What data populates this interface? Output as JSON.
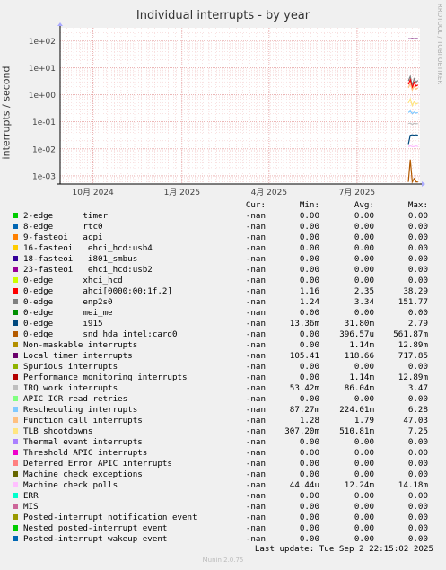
{
  "title": "Individual interrupts - by year",
  "side_text": "RRDTOOL / TOBI OETIKER",
  "ylabel": "interrupts / second",
  "header": {
    "cur": "Cur:",
    "min": "Min:",
    "avg": "Avg:",
    "max": "Max:"
  },
  "rows": [
    {
      "name": "2-edge      timer",
      "color": "#00cc00",
      "cur": "-nan",
      "min": "0.00",
      "avg": "0.00",
      "max": "0.00"
    },
    {
      "name": "8-edge      rtc0",
      "color": "#0066b3",
      "cur": "-nan",
      "min": "0.00",
      "avg": "0.00",
      "max": "0.00"
    },
    {
      "name": "9-fasteoi   acpi",
      "color": "#ff8000",
      "cur": "-nan",
      "min": "0.00",
      "avg": "0.00",
      "max": "0.00"
    },
    {
      "name": "16-fasteoi   ehci_hcd:usb4",
      "color": "#ffcc00",
      "cur": "-nan",
      "min": "0.00",
      "avg": "0.00",
      "max": "0.00"
    },
    {
      "name": "18-fasteoi   i801_smbus",
      "color": "#330099",
      "cur": "-nan",
      "min": "0.00",
      "avg": "0.00",
      "max": "0.00"
    },
    {
      "name": "23-fasteoi   ehci_hcd:usb2",
      "color": "#990099",
      "cur": "-nan",
      "min": "0.00",
      "avg": "0.00",
      "max": "0.00"
    },
    {
      "name": "0-edge      xhci_hcd",
      "color": "#ccff00",
      "cur": "-nan",
      "min": "0.00",
      "avg": "0.00",
      "max": "0.00"
    },
    {
      "name": "0-edge      ahci[0000:00:1f.2]",
      "color": "#ff0000",
      "cur": "-nan",
      "min": "1.16",
      "avg": "2.35",
      "max": "38.29"
    },
    {
      "name": "0-edge      enp2s0",
      "color": "#808080",
      "cur": "-nan",
      "min": "1.24",
      "avg": "3.34",
      "max": "151.77"
    },
    {
      "name": "0-edge      mei_me",
      "color": "#008f00",
      "cur": "-nan",
      "min": "0.00",
      "avg": "0.00",
      "max": "0.00"
    },
    {
      "name": "0-edge      i915",
      "color": "#00487d",
      "cur": "-nan",
      "min": "13.36m",
      "avg": "31.80m",
      "max": "2.79"
    },
    {
      "name": "0-edge      snd_hda_intel:card0",
      "color": "#b35a00",
      "cur": "-nan",
      "min": "0.00",
      "avg": "396.57u",
      "max": "561.87m"
    },
    {
      "name": "Non-maskable interrupts",
      "color": "#b38f00",
      "cur": "-nan",
      "min": "0.00",
      "avg": "1.14m",
      "max": "12.89m"
    },
    {
      "name": "Local timer interrupts",
      "color": "#6b006b",
      "cur": "-nan",
      "min": "105.41",
      "avg": "118.66",
      "max": "717.85"
    },
    {
      "name": "Spurious interrupts",
      "color": "#8fb300",
      "cur": "-nan",
      "min": "0.00",
      "avg": "0.00",
      "max": "0.00"
    },
    {
      "name": "Performance monitoring interrupts",
      "color": "#b30000",
      "cur": "-nan",
      "min": "0.00",
      "avg": "1.14m",
      "max": "12.89m"
    },
    {
      "name": "IRQ work interrupts",
      "color": "#bebebe",
      "cur": "-nan",
      "min": "53.42m",
      "avg": "86.04m",
      "max": "3.47"
    },
    {
      "name": "APIC ICR read retries",
      "color": "#80ff80",
      "cur": "-nan",
      "min": "0.00",
      "avg": "0.00",
      "max": "0.00"
    },
    {
      "name": "Rescheduling interrupts",
      "color": "#80c9ff",
      "cur": "-nan",
      "min": "87.27m",
      "avg": "224.01m",
      "max": "6.28"
    },
    {
      "name": "Function call interrupts",
      "color": "#ffc080",
      "cur": "-nan",
      "min": "1.28",
      "avg": "1.79",
      "max": "47.03"
    },
    {
      "name": "TLB shootdowns",
      "color": "#ffe680",
      "cur": "-nan",
      "min": "307.20m",
      "avg": "510.81m",
      "max": "7.25"
    },
    {
      "name": "Thermal event interrupts",
      "color": "#aa80ff",
      "cur": "-nan",
      "min": "0.00",
      "avg": "0.00",
      "max": "0.00"
    },
    {
      "name": "Threshold APIC interrupts",
      "color": "#ee00cc",
      "cur": "-nan",
      "min": "0.00",
      "avg": "0.00",
      "max": "0.00"
    },
    {
      "name": "Deferred Error APIC interrupts",
      "color": "#ff8080",
      "cur": "-nan",
      "min": "0.00",
      "avg": "0.00",
      "max": "0.00"
    },
    {
      "name": "Machine check exceptions",
      "color": "#666600",
      "cur": "-nan",
      "min": "0.00",
      "avg": "0.00",
      "max": "0.00"
    },
    {
      "name": "Machine check polls",
      "color": "#ffbfff",
      "cur": "-nan",
      "min": "44.44u",
      "avg": "12.24m",
      "max": "14.18m"
    },
    {
      "name": "ERR",
      "color": "#00ffcc",
      "cur": "-nan",
      "min": "0.00",
      "avg": "0.00",
      "max": "0.00"
    },
    {
      "name": "MIS",
      "color": "#cc6699",
      "cur": "-nan",
      "min": "0.00",
      "avg": "0.00",
      "max": "0.00"
    },
    {
      "name": "Posted-interrupt notification event",
      "color": "#999900",
      "cur": "-nan",
      "min": "0.00",
      "avg": "0.00",
      "max": "0.00"
    },
    {
      "name": "Nested posted-interrupt event",
      "color": "#00cc00",
      "cur": "-nan",
      "min": "0.00",
      "avg": "0.00",
      "max": "0.00"
    },
    {
      "name": "Posted-interrupt wakeup event",
      "color": "#0066b3",
      "cur": "-nan",
      "min": "0.00",
      "avg": "0.00",
      "max": "0.00"
    }
  ],
  "last_update": "Last update: Tue Sep  2 22:15:02 2025",
  "footer": "Munin 2.0.75",
  "chart_data": {
    "type": "line",
    "title": "Individual interrupts - by year",
    "ylabel": "interrupts / second",
    "yscale": "log",
    "ylim": [
      0.0005,
      300
    ],
    "yticks": [
      {
        "value": 0.001,
        "label": "1e-03"
      },
      {
        "value": 0.01,
        "label": "1e-02"
      },
      {
        "value": 0.1,
        "label": "1e-01"
      },
      {
        "value": 1,
        "label": "1e+00"
      },
      {
        "value": 10,
        "label": "1e+01"
      },
      {
        "value": 100,
        "label": "1e+02"
      }
    ],
    "xlim": [
      "2024-08-28",
      "2025-09-04"
    ],
    "xticks": [
      {
        "date": "2024-10-01",
        "label": "10月 2024"
      },
      {
        "date": "2025-01-01",
        "label": "1月 2025"
      },
      {
        "date": "2025-04-01",
        "label": "4月 2025"
      },
      {
        "date": "2025-07-01",
        "label": "7月 2025"
      }
    ],
    "grid": true,
    "data_range": [
      "2025-08-23",
      "2025-09-02"
    ],
    "series": [
      {
        "name": "Local timer interrupts",
        "color": "#6b006b",
        "values": [
          118,
          117,
          120,
          116,
          119,
          118
        ]
      },
      {
        "name": "enp2s0",
        "color": "#808080",
        "values": [
          3.3,
          4.8,
          2.2,
          3.9,
          2.9,
          3.4
        ]
      },
      {
        "name": "ahci[0000:00:1f.2]",
        "color": "#ff0000",
        "values": [
          2.4,
          3.6,
          1.8,
          2.9,
          2.1,
          2.3
        ]
      },
      {
        "name": "Function call interrupts",
        "color": "#ffc080",
        "values": [
          1.8,
          2.6,
          1.5,
          2.0,
          1.6,
          1.8
        ]
      },
      {
        "name": "TLB shootdowns",
        "color": "#ffe680",
        "values": [
          0.5,
          0.7,
          0.4,
          0.55,
          0.45,
          0.5
        ]
      },
      {
        "name": "Rescheduling interrupts",
        "color": "#80c9ff",
        "values": [
          0.22,
          0.25,
          0.2,
          0.23,
          0.21,
          0.22
        ]
      },
      {
        "name": "IRQ work interrupts",
        "color": "#bebebe",
        "values": [
          0.086,
          0.09,
          0.08,
          0.088,
          0.085,
          0.086
        ]
      },
      {
        "name": "i915",
        "color": "#00487d",
        "values": [
          0.015,
          0.032,
          0.033,
          0.032,
          0.033,
          0.032
        ]
      },
      {
        "name": "Machine check polls",
        "color": "#ffbfff",
        "values": [
          0.012,
          0.013,
          0.012,
          0.012,
          0.013,
          0.012
        ]
      },
      {
        "name": "snd_hda_intel:card0",
        "color": "#b35a00",
        "values": [
          0.0006,
          0.004,
          0.0006,
          0.0008,
          0.0006,
          0.0006
        ]
      }
    ]
  }
}
